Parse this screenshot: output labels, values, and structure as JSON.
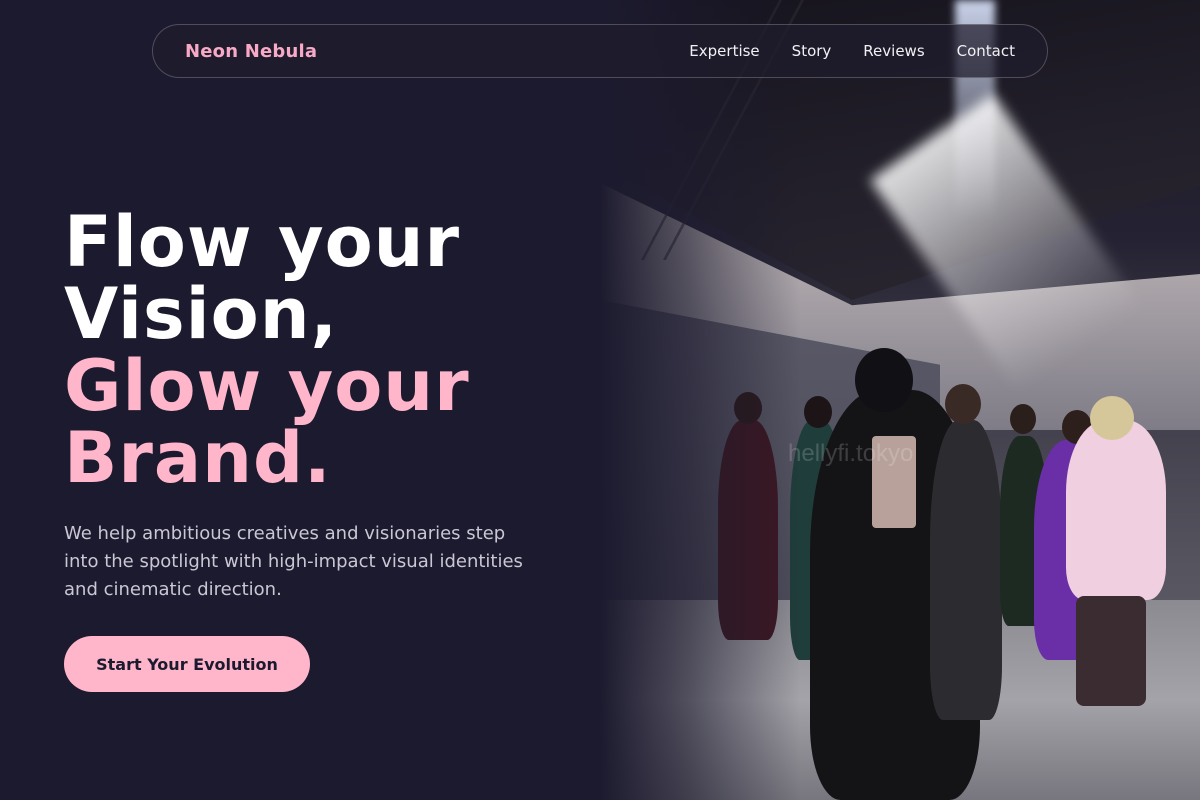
{
  "nav": {
    "brand": "Neon Nebula",
    "links": [
      "Expertise",
      "Story",
      "Reviews",
      "Contact"
    ]
  },
  "hero": {
    "title_line1": "Flow your",
    "title_line2": "Vision,",
    "title_line3": "Glow your",
    "title_line4": "Brand.",
    "description": "We help ambitious creatives and visionaries step into the spotlight with high-impact visual identities and cinematic direction.",
    "cta_label": "Start Your Evolution"
  },
  "photo": {
    "watermark": "hellyfi.tokyo"
  },
  "colors": {
    "background": "#1c1a2e",
    "accent_pink": "#ffb6cb",
    "brand_pink": "#f7a9c5",
    "text_white": "#ffffff",
    "text_muted": "#c9c7d3"
  }
}
